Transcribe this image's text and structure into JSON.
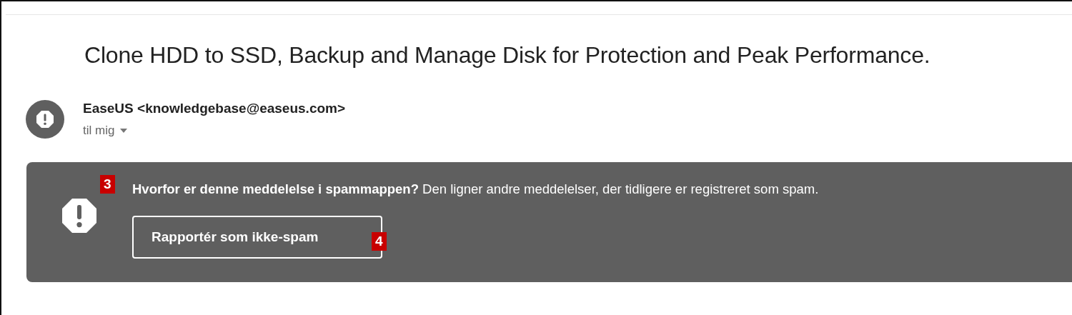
{
  "message": {
    "subject": "Clone HDD to SSD, Backup and Manage Disk for Protection and Peak Performance.",
    "sender": "EaseUS <knowledgebase@easeus.com>",
    "recipient": "til mig"
  },
  "spam_banner": {
    "marker": "3",
    "text": "**Hvorfor er denne meddelelse i spammappen?** Den ligner andre meddelelser, der tidligere er registreret som spam.",
    "button": {
      "label": "Rapportér som ikke-spam",
      "marker": "4"
    }
  }
}
